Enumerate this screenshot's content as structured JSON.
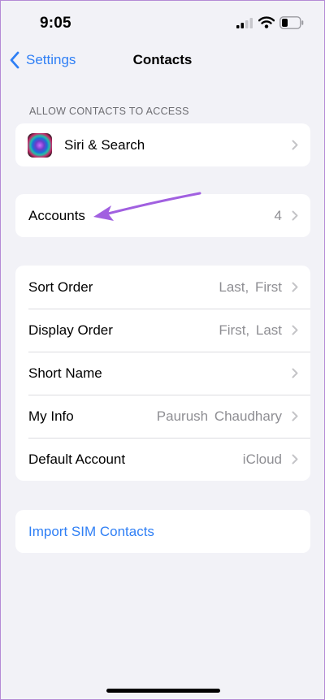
{
  "status_bar": {
    "time": "9:05",
    "icons": [
      "cellular-signal-icon",
      "wifi-icon",
      "battery-icon"
    ]
  },
  "nav": {
    "back_label": "Settings",
    "back_icon": "chevron-left-icon",
    "title": "Contacts"
  },
  "sections": {
    "access_header": "ALLOW CONTACTS TO ACCESS",
    "siri_search": {
      "label": "Siri & Search",
      "icon": "siri-icon"
    },
    "accounts": {
      "label": "Accounts",
      "value": "4"
    },
    "settings": [
      {
        "label": "Sort Order",
        "value": "Last, First"
      },
      {
        "label": "Display Order",
        "value": "First, Last"
      },
      {
        "label": "Short Name",
        "value": ""
      },
      {
        "label": "My Info",
        "value": "Paurush Chaudhary"
      },
      {
        "label": "Default Account",
        "value": "iCloud"
      }
    ],
    "import_sim": {
      "label": "Import SIM Contacts"
    }
  },
  "colors": {
    "background": "#f2f2f7",
    "accent": "#2f7ff5",
    "annotation": "#a160e0",
    "secondary_text": "#8e8e93"
  }
}
